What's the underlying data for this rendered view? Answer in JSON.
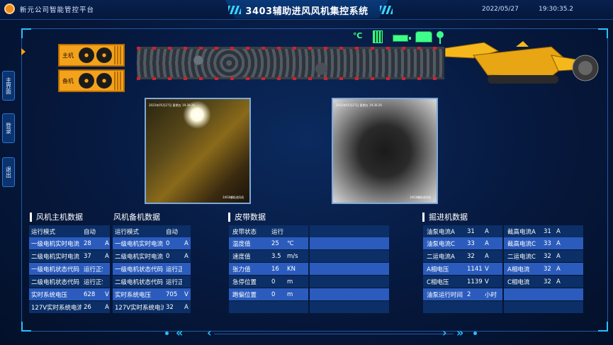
{
  "header": {
    "company": "新元公司智能管控平台",
    "title": "3403辅助进风风机集控系统",
    "date": "2022/05/27",
    "time": "19:30:35.2"
  },
  "sidenav": {
    "items": [
      {
        "label": "主界面"
      },
      {
        "label": "登录"
      },
      {
        "label": "退出"
      }
    ]
  },
  "status_icons": {
    "temp": "℃"
  },
  "fans": {
    "main_label": "主机",
    "backup_label": "备机"
  },
  "cameras": {
    "cam1_ts": "2022年05月27日 星期五 19:30:26",
    "cam2_ts": "2022年05月27日 星期五 19:30:26",
    "cam1_label": "3403辅助进风机",
    "cam2_label": "3403辅助进风机"
  },
  "main_fan": {
    "title": "风机主机数据",
    "rows": [
      {
        "label": "运行模式",
        "value": "自动",
        "unit": ""
      },
      {
        "label": "一级电机实时电流",
        "value": "28",
        "unit": "A"
      },
      {
        "label": "二级电机实时电流",
        "value": "37",
        "unit": "A"
      },
      {
        "label": "一级电机状态代码",
        "value": "运行正常",
        "unit": ""
      },
      {
        "label": "二级电机状态代码",
        "value": "运行正常",
        "unit": ""
      },
      {
        "label": "实时系统电压",
        "value": "628",
        "unit": "V"
      },
      {
        "label": "127V实时系统电流",
        "value": "26",
        "unit": "A"
      }
    ]
  },
  "backup_fan": {
    "title": "风机备机数据",
    "rows": [
      {
        "label": "运行模式",
        "value": "自动",
        "unit": ""
      },
      {
        "label": "一级电机实时电流",
        "value": "0",
        "unit": "A"
      },
      {
        "label": "二级电机实时电流",
        "value": "0",
        "unit": "A"
      },
      {
        "label": "一级电机状态代码",
        "value": "运行正常",
        "unit": ""
      },
      {
        "label": "二级电机状态代码",
        "value": "运行正常",
        "unit": ""
      },
      {
        "label": "实时系统电压",
        "value": "705",
        "unit": "V"
      },
      {
        "label": "127V实时系统电流",
        "value": "32",
        "unit": "A"
      }
    ]
  },
  "belt": {
    "title": "皮带数据",
    "rows": [
      {
        "label": "皮带状态",
        "value": "运行",
        "unit": ""
      },
      {
        "label": "温度值",
        "value": "25",
        "unit": "℃"
      },
      {
        "label": "速度值",
        "value": "3.5",
        "unit": "m/s"
      },
      {
        "label": "张力值",
        "value": "16",
        "unit": "KN"
      },
      {
        "label": "急停位置",
        "value": "0",
        "unit": "m"
      },
      {
        "label": "跑偏位置",
        "value": "0",
        "unit": "m"
      }
    ]
  },
  "excavator": {
    "title": "掘进机数据",
    "left_rows": [
      {
        "label": "油泵电流A",
        "value": "31",
        "unit": "A"
      },
      {
        "label": "油泵电流C",
        "value": "33",
        "unit": "A"
      },
      {
        "label": "二运电流A",
        "value": "32",
        "unit": "A"
      },
      {
        "label": "A相电压",
        "value": "1141",
        "unit": "V"
      },
      {
        "label": "C相电压",
        "value": "1139",
        "unit": "V"
      },
      {
        "label": "油泵运行时间",
        "value": "2",
        "unit": "小时"
      }
    ],
    "right_rows": [
      {
        "label": "截高电流A",
        "value": "31",
        "unit": "A"
      },
      {
        "label": "截高电流C",
        "value": "33",
        "unit": "A"
      },
      {
        "label": "二运电流C",
        "value": "32",
        "unit": "A"
      },
      {
        "label": "A相电流",
        "value": "32",
        "unit": "A"
      },
      {
        "label": "C相电流",
        "value": "32",
        "unit": "A"
      },
      {
        "label": "",
        "value": "",
        "unit": ""
      }
    ]
  }
}
